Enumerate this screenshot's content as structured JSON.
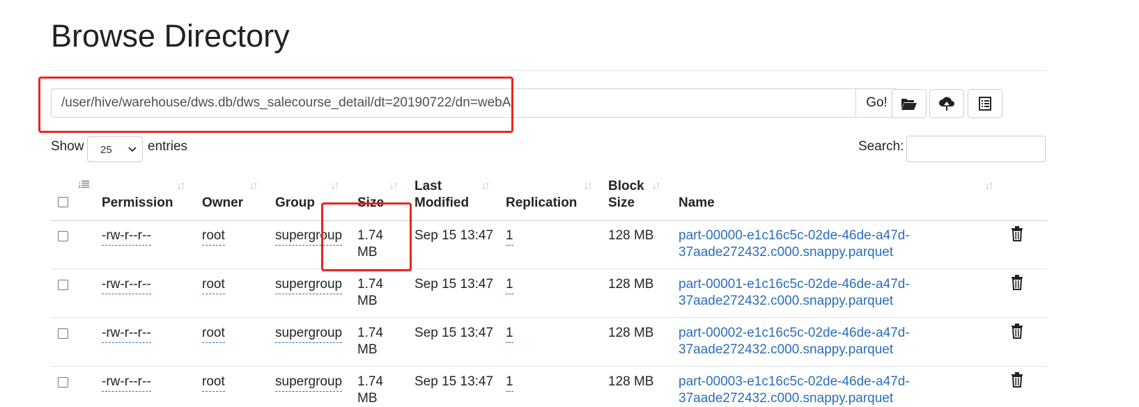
{
  "page": {
    "title": "Browse Directory"
  },
  "path_bar": {
    "value": "/user/hive/warehouse/dws.db/dws_salecourse_detail/dt=20190722/dn=webA",
    "go_label": "Go!"
  },
  "toolbar": {
    "icons": [
      "folder-open-icon",
      "cloud-upload-icon",
      "list-icon"
    ]
  },
  "controls": {
    "show_label": "Show",
    "page_size": "25",
    "entries_label": "entries",
    "search_label": "Search:"
  },
  "table": {
    "columns": [
      "Permission",
      "Owner",
      "Group",
      "Size",
      "Last Modified",
      "Replication",
      "Block Size",
      "Name"
    ],
    "header_lines": {
      "last_modified_1": "Last",
      "last_modified_2": "Modified",
      "block_size_1": "Block",
      "block_size_2": "Size"
    },
    "rows": [
      {
        "permission": "-rw-r--r--",
        "owner": "root",
        "group": "supergroup",
        "size_1": "1.74",
        "size_2": "MB",
        "modified": "Sep 15 13:47",
        "replication": "1",
        "block_size": "128 MB",
        "name_1": "part-00000-e1c16c5c-02de-46de-a47d-",
        "name_2": "37aade272432.c000.snappy.parquet"
      },
      {
        "permission": "-rw-r--r--",
        "owner": "root",
        "group": "supergroup",
        "size_1": "1.74",
        "size_2": "MB",
        "modified": "Sep 15 13:47",
        "replication": "1",
        "block_size": "128 MB",
        "name_1": "part-00001-e1c16c5c-02de-46de-a47d-",
        "name_2": "37aade272432.c000.snappy.parquet"
      },
      {
        "permission": "-rw-r--r--",
        "owner": "root",
        "group": "supergroup",
        "size_1": "1.74",
        "size_2": "MB",
        "modified": "Sep 15 13:47",
        "replication": "1",
        "block_size": "128 MB",
        "name_1": "part-00002-e1c16c5c-02de-46de-a47d-",
        "name_2": "37aade272432.c000.snappy.parquet"
      },
      {
        "permission": "-rw-r--r--",
        "owner": "root",
        "group": "supergroup",
        "size_1": "1.74",
        "size_2": "MB",
        "modified": "Sep 15 13:47",
        "replication": "1",
        "block_size": "128 MB",
        "name_1": "part-00003-e1c16c5c-02de-46de-a47d-",
        "name_2": "37aade272432.c000.snappy.parquet"
      }
    ]
  },
  "colors": {
    "link": "#2a6ebb",
    "annotation_red": "#e8261f"
  }
}
